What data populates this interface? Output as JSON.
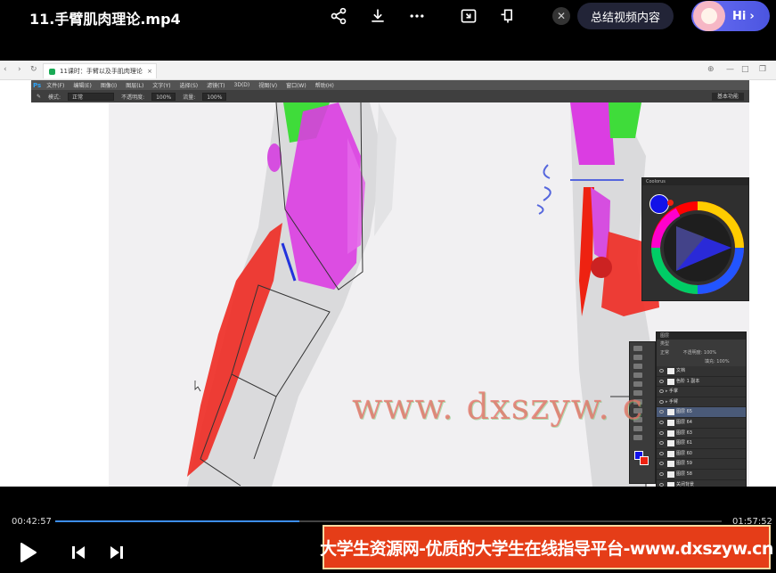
{
  "video": {
    "title": "11.手臂肌肉理论.mp4",
    "summary_button": "总结视频内容",
    "assistant_greeting": "Hi",
    "current_time": "00:42:57",
    "total_time": "01:57:52",
    "progress_fraction": 0.366
  },
  "top_icons": [
    "share-icon",
    "download-icon",
    "more-icon",
    "picture-in-picture-icon",
    "pin-window-icon",
    "close-icon",
    "chevron-right-icon"
  ],
  "browser": {
    "tab_title": "11课时：手臂以及手肌肉理论",
    "tab_close": "×"
  },
  "photoshop": {
    "logo": "Ps",
    "menu": [
      "文件(F)",
      "编辑(E)",
      "图像(I)",
      "图层(L)",
      "文字(Y)",
      "选择(S)",
      "滤镜(T)",
      "3D(D)",
      "视图(V)",
      "窗口(W)",
      "帮助(H)"
    ],
    "options": {
      "mode_label": "模式:",
      "mode_value": "正常",
      "opacity_label": "不透明度:",
      "opacity_value": "100%",
      "flow_label": "流量:",
      "flow_value": "100%",
      "workspace": "基本功能"
    },
    "color_panel_title": "Coolorus",
    "layers_panel": {
      "title": "图层",
      "kind": "类型",
      "blend": "正常",
      "opacity_label": "不透明度:",
      "opacity_value": "100%",
      "fill_label": "填充:",
      "fill_value": "100%",
      "rows": [
        {
          "name": "文档",
          "type": "layer"
        },
        {
          "name": "色阶 1 副本",
          "type": "layer"
        },
        {
          "name": "手掌",
          "type": "group"
        },
        {
          "name": "手臂",
          "type": "group"
        },
        {
          "name": "图层 65",
          "type": "layer",
          "selected": true
        },
        {
          "name": "图层 64",
          "type": "layer"
        },
        {
          "name": "图层 63",
          "type": "layer"
        },
        {
          "name": "图层 61",
          "type": "layer"
        },
        {
          "name": "图层 60",
          "type": "layer"
        },
        {
          "name": "图层 59",
          "type": "layer"
        },
        {
          "name": "图层 58",
          "type": "layer"
        },
        {
          "name": "关闭背景",
          "type": "layer"
        },
        {
          "name": "图层 1",
          "type": "layer"
        }
      ]
    },
    "watermark": "www. dxszyw. c"
  },
  "footer_banner": "大学生资源网-优质的大学生在线指导平台-www.dxszyw.cn"
}
